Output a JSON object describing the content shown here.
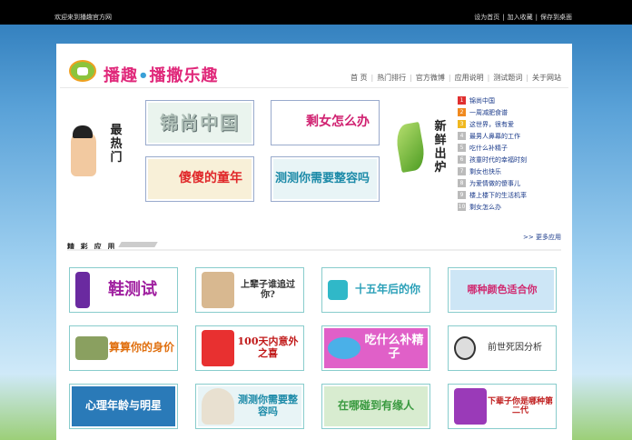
{
  "topbar": {
    "welcome": "欢迎来到播趣官方网",
    "links": [
      "设为首页",
      "加入收藏",
      "保存到桌面"
    ]
  },
  "logo": {
    "text_a": "播趣",
    "dot": "•",
    "text_b": "播撒乐趣"
  },
  "nav": [
    "首 页",
    "热门排行",
    "官方微博",
    "应用说明",
    "测试题词",
    "关于网站"
  ],
  "hot": {
    "label": "最热门",
    "banners": [
      "锦尚中国",
      "剩女怎么办",
      "傻傻的童年",
      "测测你需要整容吗"
    ]
  },
  "fresh": {
    "label": "新鲜出炉"
  },
  "rank": [
    {
      "n": "1",
      "t": "锦尚中国"
    },
    {
      "n": "2",
      "t": "一周减肥食谱"
    },
    {
      "n": "3",
      "t": "这世界，很有爱"
    },
    {
      "n": "4",
      "t": "最男人鼻幕的工作"
    },
    {
      "n": "5",
      "t": "吃什么补精子"
    },
    {
      "n": "6",
      "t": "孩童时代的幸福时刻"
    },
    {
      "n": "7",
      "t": "剩女也快乐"
    },
    {
      "n": "8",
      "t": "为爱情做的傻事儿"
    },
    {
      "n": "9",
      "t": "楼上楼下的生活机率"
    },
    {
      "n": "10",
      "t": "剩女怎么办"
    }
  ],
  "apps": {
    "title": "精 彩 应 用",
    "more": ">> 更多应用",
    "cards": [
      [
        "鞋测试",
        "上辈子谁追过你?",
        "十五年后的你",
        "哪种颜色适合你"
      ],
      [
        "算算你的身价",
        "100天内意外之喜",
        "吃什么补精子",
        "前世死因分析"
      ],
      [
        "心理年龄与明星",
        "测测你需要整容吗",
        "在哪碰到有缘人",
        "下辈子你是哪种第二代"
      ]
    ]
  },
  "colors": {
    "accent": "#e0287a",
    "link": "#1a3a8a"
  }
}
